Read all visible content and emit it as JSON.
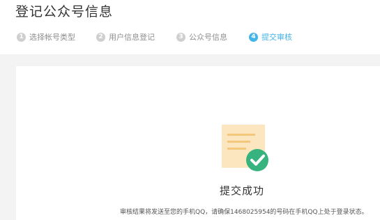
{
  "page": {
    "title": "登记公众号信息"
  },
  "steps": [
    {
      "number": "1",
      "label": "选择帐号类型",
      "active": false
    },
    {
      "number": "2",
      "label": "用户信息登记",
      "active": false
    },
    {
      "number": "3",
      "label": "公众号信息",
      "active": false
    },
    {
      "number": "4",
      "label": "提交审核",
      "active": true
    }
  ],
  "result": {
    "title": "提交成功",
    "description": "审核结果将发送至您的手机QQ，请确保1468025954的号码在手机QQ上处于登录状态。"
  },
  "icons": {
    "success": "document-check-icon"
  },
  "colors": {
    "accent": "#44b5e8",
    "step_inactive": "#cfcfcf",
    "success_green": "#36b37e",
    "document": "#fbe6bf"
  }
}
